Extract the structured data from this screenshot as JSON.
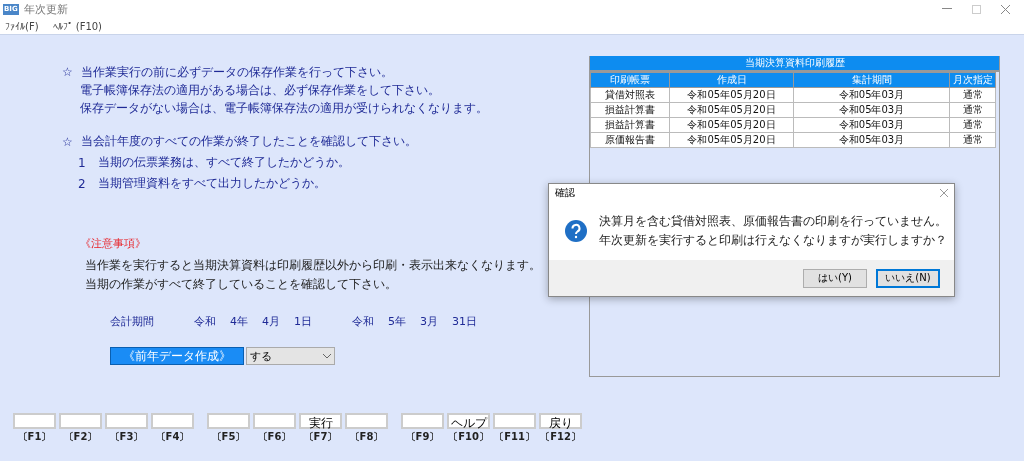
{
  "window": {
    "title": "年次更新",
    "app_badge": "BIG"
  },
  "menu": [
    "ﾌｧｲﾙ(F)",
    "ﾍﾙﾌﾟ (F10)"
  ],
  "instructions": [
    {
      "kind": "heading",
      "mark": "☆",
      "text": "当作業実行の前に必ずデータの保存作業を行って下さい。"
    },
    {
      "kind": "line",
      "text": "電子帳簿保存法の適用がある場合は、必ず保存作業をして下さい。"
    },
    {
      "kind": "line",
      "text": "保存データがない場合は、電子帳簿保存法の適用が受けられなくなります。"
    },
    {
      "kind": "heading",
      "mark": "☆",
      "text": "当会計年度のすべての作業が終了したことを確認して下さい。"
    },
    {
      "kind": "item",
      "mark": "1",
      "text": "当期の伝票業務は、すべて終了したかどうか。"
    },
    {
      "kind": "item",
      "mark": "2",
      "text": "当期管理資料をすべて出力したかどうか。"
    }
  ],
  "notice": {
    "title": "《注意事項》",
    "lines": [
      "当作業を実行すると当期決算資料は印刷履歴以外から印刷・表示出来なくなります。",
      "当期の作業がすべて終了していることを確認して下さい。"
    ]
  },
  "period": {
    "label": "会計期間",
    "start": [
      "令和",
      "4年",
      "4月",
      "1日"
    ],
    "end": [
      "令和",
      "5年",
      "3月",
      "31日"
    ]
  },
  "prev_year_data": {
    "label": "《前年データ作成》",
    "value": "する"
  },
  "history": {
    "title": "当期決算資料印刷履歴",
    "columns": [
      "印刷帳票",
      "作成日",
      "集計期間",
      "月次指定"
    ],
    "rows": [
      [
        "貸借対照表",
        "令和05年05月20日",
        "令和05年03月",
        "通常"
      ],
      [
        "損益計算書",
        "令和05年05月20日",
        "令和05年03月",
        "通常"
      ],
      [
        "損益計算書",
        "令和05年05月20日",
        "令和05年03月",
        "通常"
      ],
      [
        "原価報告書",
        "令和05年05月20日",
        "令和05年03月",
        "通常"
      ]
    ]
  },
  "function_keys": [
    {
      "key": "〔F1〕"
    },
    {
      "key": "〔F2〕"
    },
    {
      "key": "〔F3〕"
    },
    {
      "key": "〔F4〕"
    },
    {
      "key": "〔F5〕"
    },
    {
      "key": "〔F6〕"
    },
    {
      "key": "〔F7〕",
      "label": "実行"
    },
    {
      "key": "〔F8〕"
    },
    {
      "key": "〔F9〕"
    },
    {
      "key": "〔F10〕",
      "label": "ヘルプ"
    },
    {
      "key": "〔F11〕"
    },
    {
      "key": "〔F12〕",
      "label": "戻り"
    }
  ],
  "dialog": {
    "title": "確認",
    "message": [
      "決算月を含む貸借対照表、原価報告書の印刷を行っていません。",
      "年次更新を実行すると印刷は行えなくなりますが実行しますか？"
    ],
    "buttons": [
      {
        "label": "はい(Y)",
        "focused": false
      },
      {
        "label": "いいえ(N)",
        "focused": true
      }
    ]
  }
}
